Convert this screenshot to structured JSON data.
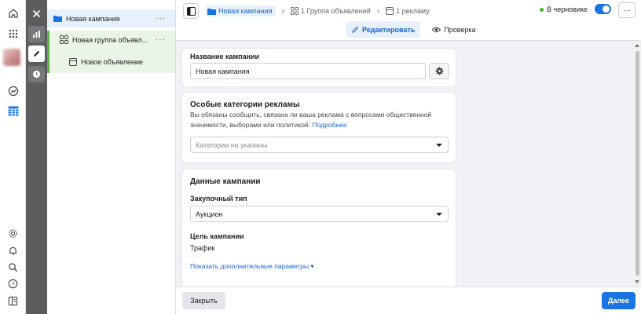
{
  "tree": {
    "campaign": "Новая кампания",
    "adset": "Новая группа объявл...",
    "ad": "Новое объявление",
    "more": "···"
  },
  "breadcrumbs": {
    "campaign": "Новая кампания",
    "adset": "1 Группа объявлений",
    "ad": "1 рекламу"
  },
  "status": {
    "draft": "В черновике",
    "toggle_on": true,
    "more": "···"
  },
  "tabs": {
    "edit": "Редактировать",
    "review": "Проверка"
  },
  "campaign_name": {
    "label": "Название кампании",
    "value": "Новая кампания"
  },
  "special": {
    "title": "Особые категории рекламы",
    "description": "Вы обязаны сообщить, связана ли ваша реклама с вопросами общественной значимости, выборами или политикой.",
    "more_link": "Подробнее",
    "placeholder": "Категории не указаны"
  },
  "details": {
    "title": "Данные кампании",
    "buying_label": "Закупочный тип",
    "buying_value": "Аукцион",
    "objective_label": "Цель кампании",
    "objective_value": "Трафик",
    "advanced_link": "Показать дополнительные параметры ▾"
  },
  "footer": {
    "close": "Закрыть",
    "next": "Далее"
  },
  "colors": {
    "accent": "#1b74e4",
    "draft_dot": "#42b72a",
    "adset_green": "#5fb247"
  }
}
